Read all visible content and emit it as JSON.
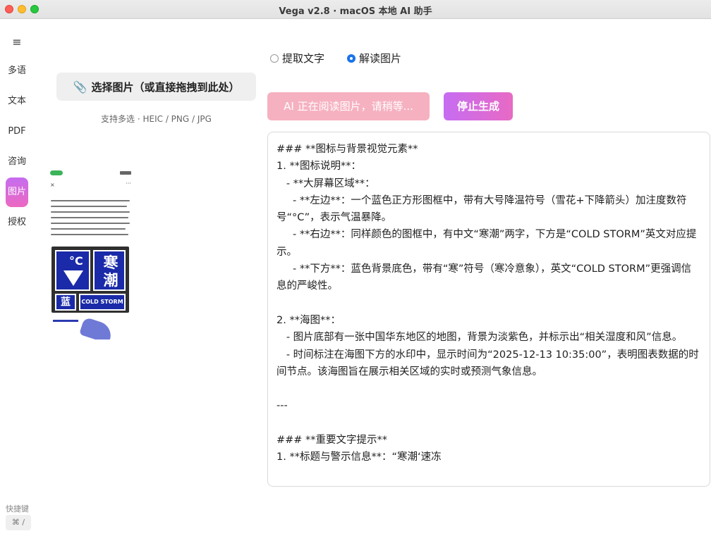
{
  "window": {
    "title": "Vega v2.8 · macOS 本地 AI 助手"
  },
  "sidebar": {
    "menu_icon": "hamburger-icon",
    "items": [
      {
        "label": "多语",
        "active": false
      },
      {
        "label": "文本",
        "active": false
      },
      {
        "label": "PDF",
        "active": false
      },
      {
        "label": "咨询",
        "active": false
      },
      {
        "label": "图片",
        "active": true
      },
      {
        "label": "授权",
        "active": false
      }
    ],
    "shortcut_label": "快捷键",
    "shortcut_key": "⌘ /"
  },
  "left_panel": {
    "choose_button_icon": "paperclip-icon",
    "choose_button_label": "选择图片（或直接拖拽到此处）",
    "formats": "支持多选 · HEIC / PNG / JPG",
    "thumbnail": {
      "warning_cn": "寒潮",
      "warning_unit": "°C",
      "warning_level": "蓝",
      "warning_en": "COLD STORM"
    }
  },
  "mode": {
    "options": [
      {
        "label": "提取文字",
        "checked": false
      },
      {
        "label": "解读图片",
        "checked": true
      }
    ]
  },
  "actions": {
    "status_label": "AI 正在阅读图片，请稍等...",
    "stop_label": "停止生成"
  },
  "output": {
    "text": "### **图标与背景视觉元素**\n1. **图标说明**：\n   - **大屏幕区域**：\n     - **左边**：一个蓝色正方形图框中，带有大号降温符号（雪花+下降箭头）加注度数符号“°C”，表示气温暴降。\n     - **右边**：同样颜色的图框中，有中文“寒潮”两字，下方是“COLD STORM”英文对应提示。\n     - **下方**：蓝色背景底色，带有“寒”符号（寒冷意象），英文“COLD STORM”更强调信息的严峻性。\n\n2. **海图**：\n   - 图片底部有一张中国华东地区的地图，背景为淡紫色，并标示出“相关湿度和风”信息。\n   - 时间标注在海图下方的水印中，显示时间为“2025-12-13 10:35:00”，表明图表数据的时间节点。该海图旨在展示相关区域的实时或预测气象信息。\n\n---\n\n### **重要文字提示**\n1. **标题与警示信息**：“寒潮‘速冻"
  },
  "colors": {
    "accent": "#1a73e8",
    "stop_button_start": "#c66cf2",
    "stop_button_end": "#e86ac4",
    "status_button": "#f6adbd"
  }
}
